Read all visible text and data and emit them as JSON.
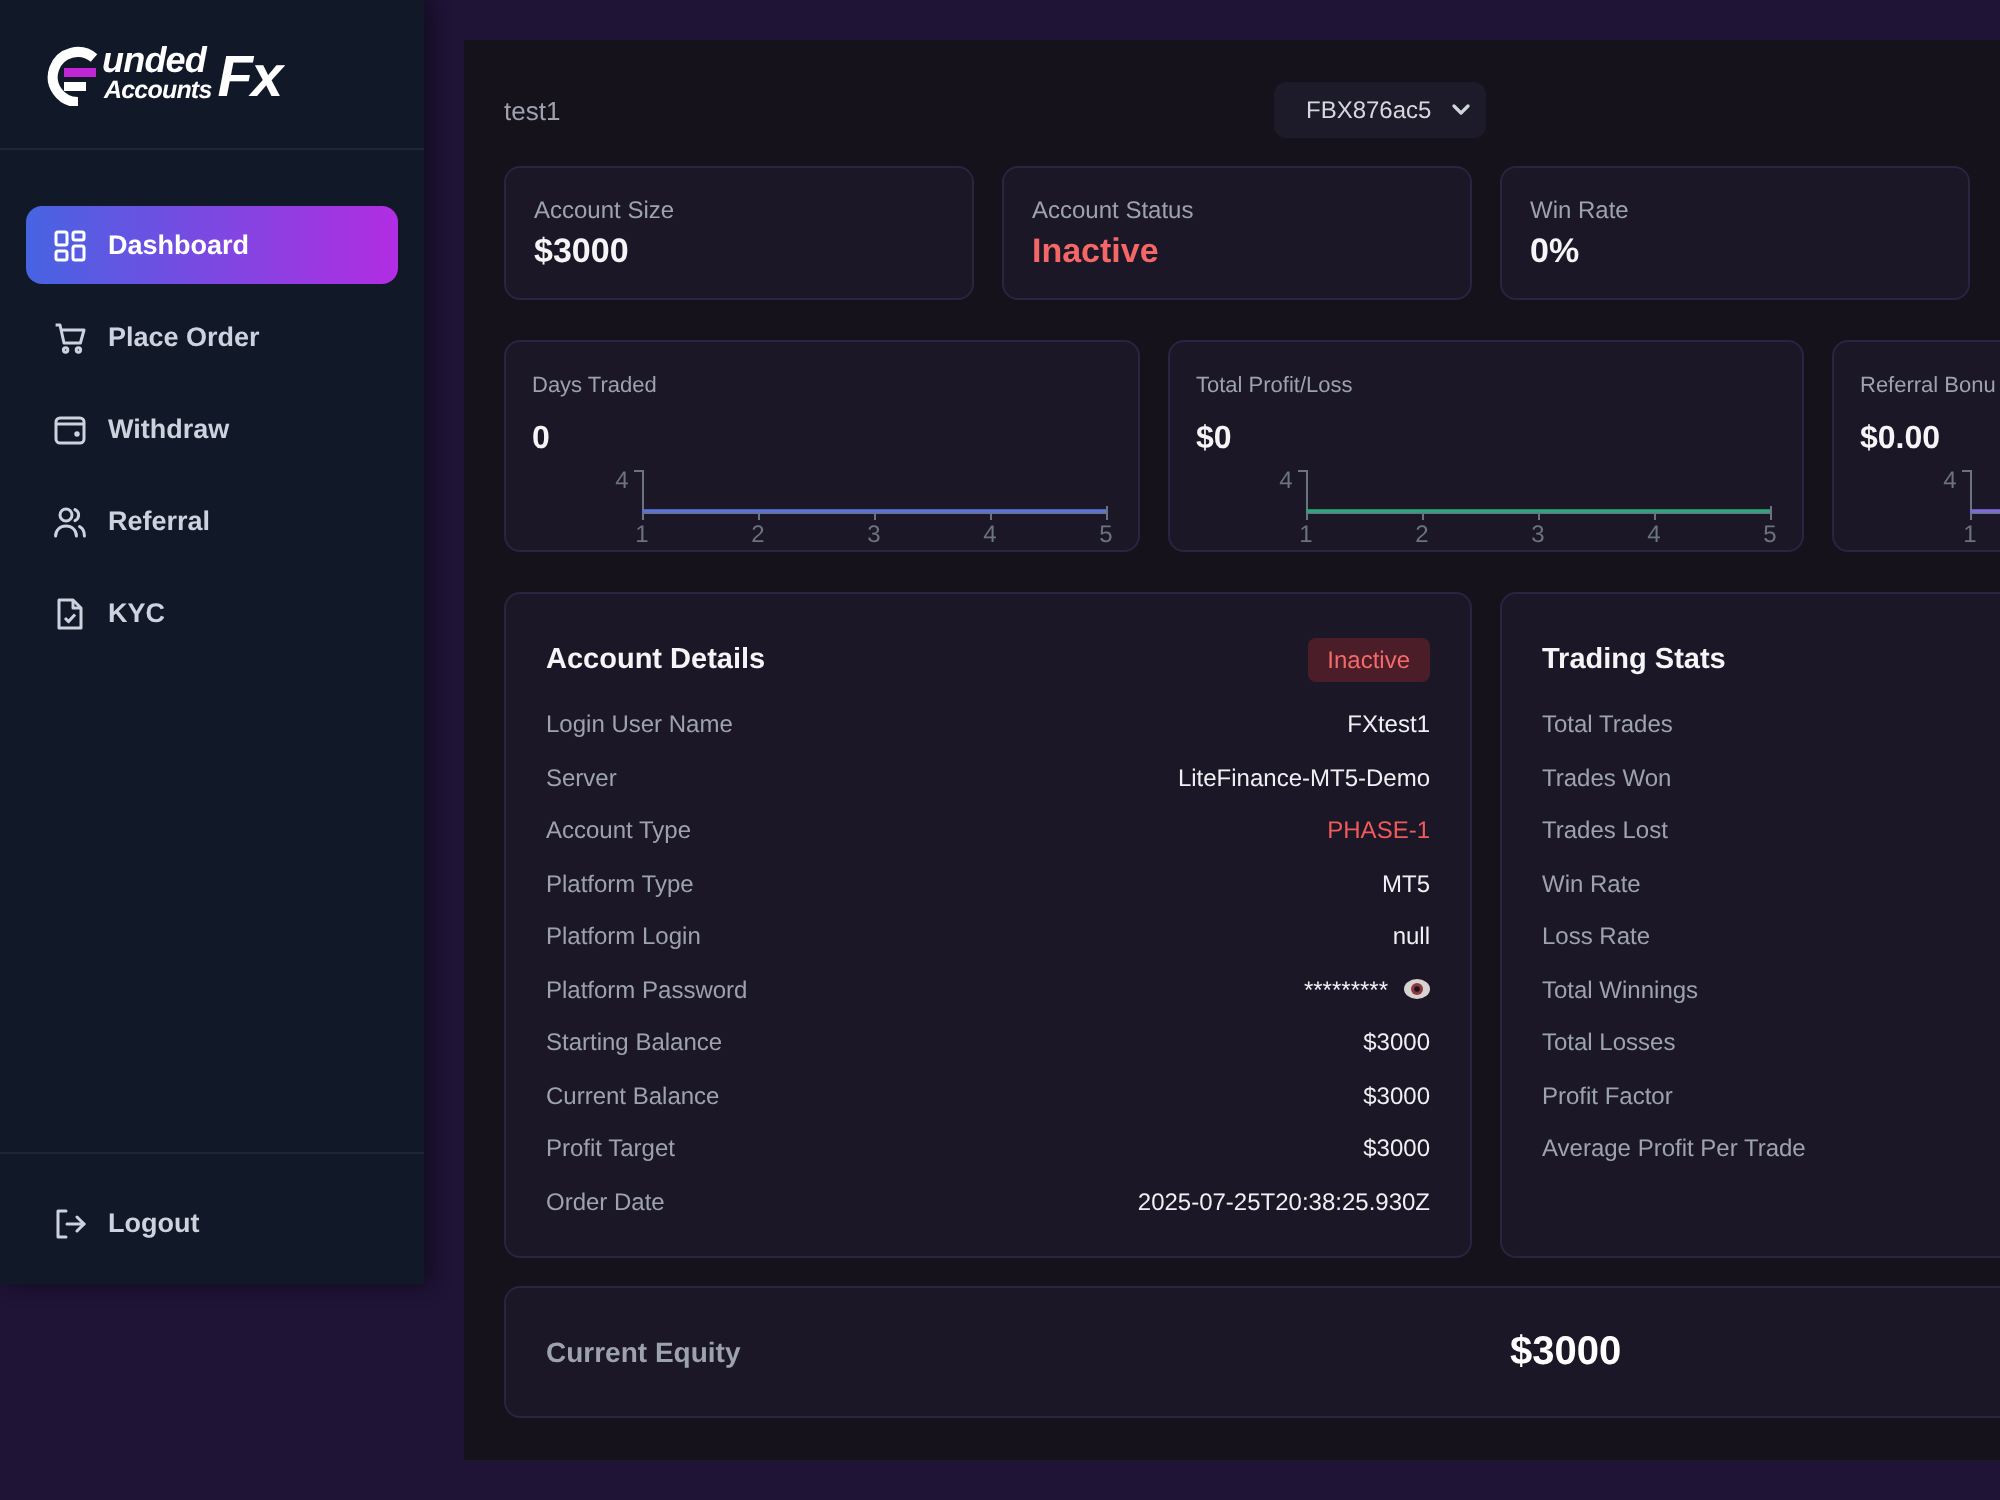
{
  "sidebar": {
    "logo": {
      "top_word": "unded",
      "bottom_word": "Accounts",
      "suffix": "Fx"
    },
    "nav_items": [
      {
        "label": "Dashboard",
        "selected": true
      },
      {
        "label": "Place Order",
        "selected": false
      },
      {
        "label": "Withdraw",
        "selected": false
      },
      {
        "label": "Referral",
        "selected": false
      },
      {
        "label": "KYC",
        "selected": false
      }
    ],
    "logout": {
      "label": "Logout"
    }
  },
  "header": {
    "user": "test1",
    "account_select": {
      "value": "FBX876ac5"
    }
  },
  "summary_cards": [
    {
      "label": "Account Size",
      "value": "$3000",
      "kind": "plain"
    },
    {
      "label": "Account Status",
      "value": "Inactive",
      "kind": "alert"
    },
    {
      "label": "Win Rate",
      "value": "0%",
      "kind": "plain"
    }
  ],
  "metric_cards": [
    {
      "label": "Days Traded",
      "value": "0",
      "color": "#5b73d6",
      "y_tick": "4",
      "x_ticks": [
        "1",
        "2",
        "3",
        "4",
        "5"
      ]
    },
    {
      "label": "Total Profit/Loss",
      "value": "$0",
      "color": "#2fa37a",
      "y_tick": "4",
      "x_ticks": [
        "1",
        "2",
        "3",
        "4",
        "5"
      ]
    },
    {
      "label": "Referral Bonu",
      "value": "$0.00",
      "color": "#7c6bd6",
      "y_tick": "4",
      "x_ticks": [
        "1"
      ]
    }
  ],
  "account_details": {
    "title": "Account Details",
    "status_badge": "Inactive",
    "rows": [
      {
        "label": "Login User Name",
        "value": "FXtest1",
        "kind": "plain"
      },
      {
        "label": "Server",
        "value": "LiteFinance-MT5-Demo",
        "kind": "plain"
      },
      {
        "label": "Account Type",
        "value": "PHASE-1",
        "kind": "alert"
      },
      {
        "label": "Platform Type",
        "value": "MT5",
        "kind": "plain"
      },
      {
        "label": "Platform Login",
        "value": "null",
        "kind": "plain"
      },
      {
        "label": "Platform Password",
        "value": "*********",
        "kind": "secret"
      },
      {
        "label": "Starting Balance",
        "value": "$3000",
        "kind": "plain"
      },
      {
        "label": "Current Balance",
        "value": "$3000",
        "kind": "plain"
      },
      {
        "label": "Profit Target",
        "value": "$3000",
        "kind": "plain"
      },
      {
        "label": "Order Date",
        "value": "2025-07-25T20:38:25.930Z",
        "kind": "plain"
      }
    ]
  },
  "trading_stats": {
    "title": "Trading Stats",
    "labels": [
      "Total Trades",
      "Trades Won",
      "Trades Lost",
      "Win Rate",
      "Loss Rate",
      "Total Winnings",
      "Total Losses",
      "Profit Factor",
      "Average Profit Per Trade"
    ]
  },
  "current_equity": {
    "label": "Current Equity",
    "value": "$3000"
  }
}
